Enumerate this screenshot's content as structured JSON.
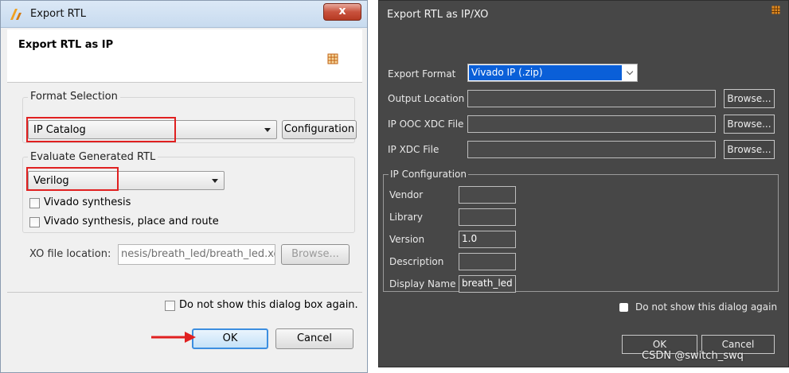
{
  "left_dialog": {
    "title": "Export RTL",
    "close_glyph": "x",
    "header": "Export RTL as IP",
    "format_group_label": "Format Selection",
    "format_value": "IP Catalog",
    "configuration_button": "Configuration",
    "evaluate_group_label": "Evaluate Generated RTL",
    "language_value": "Verilog",
    "vivado_synthesis_label": "Vivado synthesis",
    "vivado_synthesis_checked": false,
    "vivado_pnr_label": "Vivado synthesis, place and route",
    "vivado_pnr_checked": false,
    "xo_label": "XO file location:",
    "xo_value": "nesis/breath_led/breath_led.xo",
    "browse_button": "Browse...",
    "do_not_show_label": "Do not show this dialog box again.",
    "ok_button": "OK",
    "cancel_button": "Cancel"
  },
  "right_dialog": {
    "title": "Export RTL as IP/XO",
    "export_format_label": "Export Format",
    "export_format_value": "Vivado IP (.zip)",
    "output_location_label": "Output Location",
    "output_location_value": "",
    "ooc_xdc_label": "IP OOC XDC File",
    "ooc_xdc_value": "",
    "xdc_label": "IP XDC File",
    "xdc_value": "",
    "browse_button": "Browse...",
    "ip_config_legend": "IP Configuration",
    "vendor_label": "Vendor",
    "vendor_value": "",
    "library_label": "Library",
    "library_value": "",
    "version_label": "Version",
    "version_value": "1.0",
    "description_label": "Description",
    "description_value": "",
    "display_name_label": "Display Name",
    "display_name_value": "breath_led",
    "do_not_show_label": "Do not show this dialog again",
    "ok_button": "OK",
    "cancel_button": "Cancel"
  },
  "watermark": "CSDN @switch_swq",
  "colors": {
    "highlight_red": "#e02020",
    "dark_bg": "#474747",
    "selection_blue": "#0a5fd8"
  },
  "icons": {
    "left_logo": "vitis-hls-logo-icon",
    "rtl_icon": "ip-grid-icon",
    "annotation": "red-arrow-icon"
  }
}
